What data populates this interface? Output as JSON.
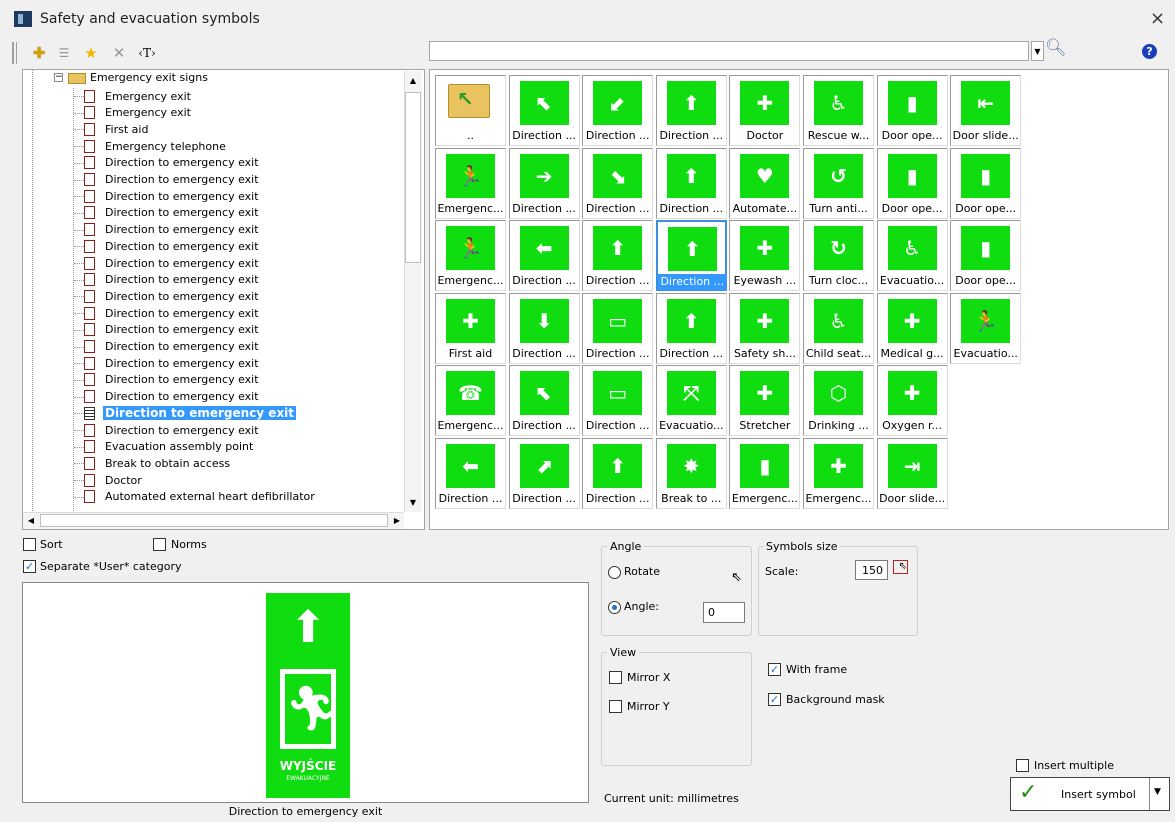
{
  "window": {
    "title": "Safety and evacuation symbols",
    "close": "×"
  },
  "toolbar": {
    "add_icon": "✚",
    "list_icon": "☰",
    "favorite_icon": "★",
    "delete_icon": "✕",
    "text_icon": "‹T›"
  },
  "search": {
    "value": "",
    "help": "?"
  },
  "tree": {
    "category": "Emergency exit signs",
    "items": [
      "Emergency exit",
      "Emergency exit",
      "First aid",
      "Emergency telephone",
      "Direction to emergency exit",
      "Direction to emergency exit",
      "Direction to emergency exit",
      "Direction to emergency exit",
      "Direction to emergency exit",
      "Direction to emergency exit",
      "Direction to emergency exit",
      "Direction to emergency exit",
      "Direction to emergency exit",
      "Direction to emergency exit",
      "Direction to emergency exit",
      "Direction to emergency exit",
      "Direction to emergency exit",
      "Direction to emergency exit",
      "Direction to emergency exit",
      "Direction to emergency exit",
      "Direction to emergency exit",
      "Evacuation assembly point",
      "Break to obtain access",
      "Doctor",
      "Automated external heart defibrillator"
    ],
    "selected_index": 19
  },
  "symbols": [
    [
      "..",
      "Direction ...",
      "Direction ...",
      "Direction ...",
      "Doctor",
      "Rescue w...",
      "Door ope...",
      "Door slide..."
    ],
    [
      "Emergenc...",
      "Direction ...",
      "Direction ...",
      "Direction ...",
      "Automate...",
      "Turn anti...",
      "Door ope...",
      "Door ope..."
    ],
    [
      "Emergenc...",
      "Direction ...",
      "Direction ...",
      "Direction ...",
      "Eyewash ...",
      "Turn cloc...",
      "Evacuatio...",
      "Door ope..."
    ],
    [
      "First aid",
      "Direction ...",
      "Direction ...",
      "Direction ...",
      "Safety sh...",
      "Child seat...",
      "Medical g...",
      "Evacuatio..."
    ],
    [
      "Emergenc...",
      "Direction ...",
      "Direction ...",
      "Evacuatio...",
      "Stretcher",
      "Drinking ...",
      "Oxygen r..."
    ],
    [
      "Direction ...",
      "Direction ...",
      "Direction ...",
      "Break to ...",
      "Emergenc...",
      "Emergenc...",
      "Door slide..."
    ]
  ],
  "symbol_glyphs": [
    [
      "",
      "⬉",
      "⬋",
      "⬆",
      "✚",
      "♿",
      "▮",
      "⇤"
    ],
    [
      "🏃",
      "➔",
      "⬊",
      "⬆",
      "♥",
      "↺",
      "▮",
      "▮"
    ],
    [
      "🏃",
      "⬅",
      "⬆",
      "⬆",
      "✚",
      "↻",
      "♿",
      "▮"
    ],
    [
      "✚",
      "⬇",
      "▭",
      "⬆",
      "✚",
      "♿",
      "✚",
      "🏃"
    ],
    [
      "☎",
      "⬉",
      "▭",
      "⤧",
      "✚",
      "⬡",
      "✚"
    ],
    [
      "⬅",
      "⬈",
      "⬆",
      "✸",
      "▮",
      "✚",
      "⇥"
    ]
  ],
  "selected_symbol": {
    "row": 2,
    "col": 3
  },
  "options": {
    "sort": "Sort",
    "norms": "Norms",
    "separate": "Separate *User* category"
  },
  "angle": {
    "title": "Angle",
    "rotate": "Rotate",
    "angle_label": "Angle:",
    "angle_value": "0"
  },
  "size": {
    "title": "Symbols size",
    "scale_label": "Scale:",
    "scale_value": "150"
  },
  "view": {
    "title": "View",
    "mirror_x": "Mirror X",
    "mirror_y": "Mirror Y"
  },
  "frame": {
    "with_frame": "With frame",
    "background_mask": "Background mask"
  },
  "preview": {
    "caption": "Direction to emergency exit",
    "sign_text": "WYJŚCIE",
    "sign_subtext": "EWAKUACYJNE"
  },
  "unit": "Current unit: millimetres",
  "insert": {
    "multiple": "Insert multiple",
    "button": "Insert symbol"
  },
  "colors": {
    "sign_green": "#10dd10",
    "selection": "#3399ff"
  }
}
